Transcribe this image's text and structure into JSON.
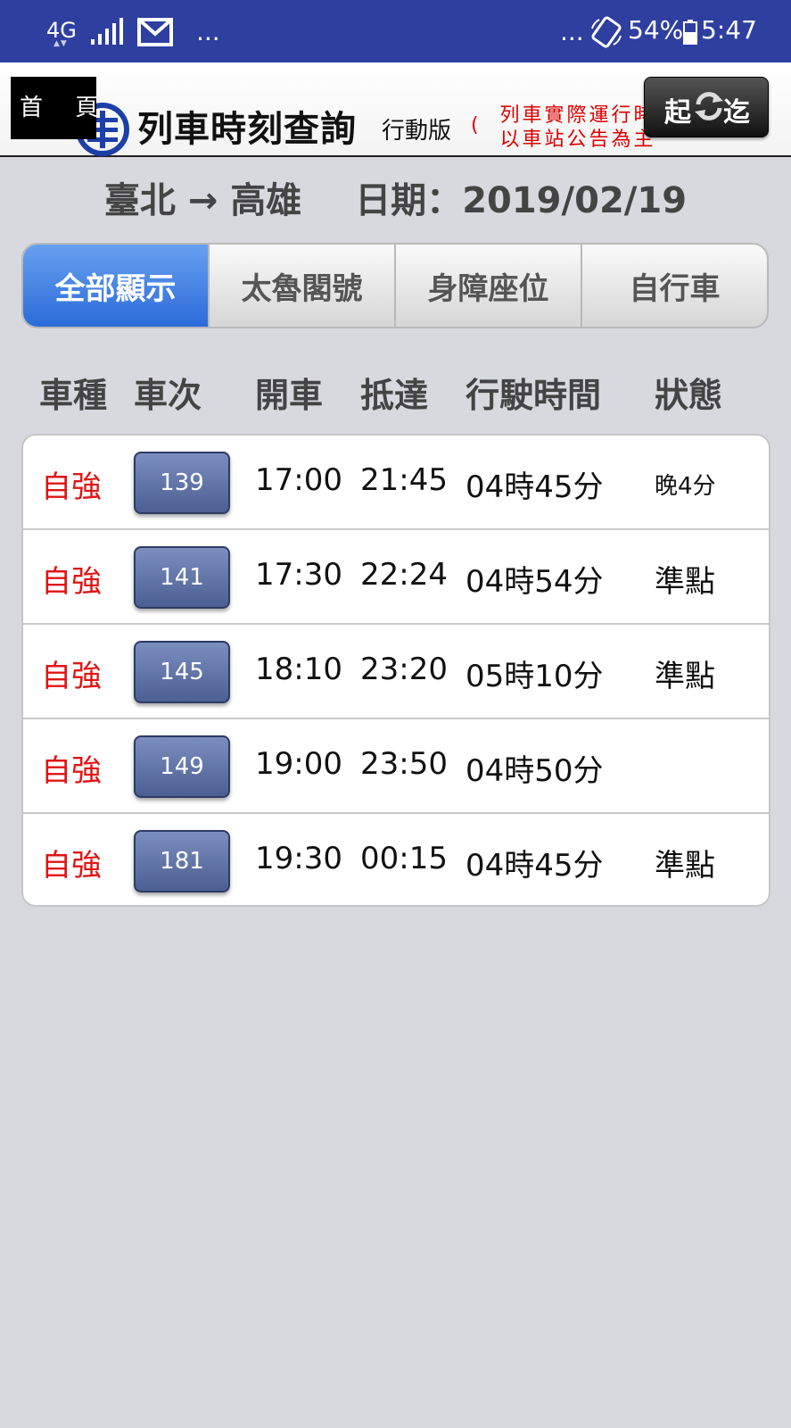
{
  "status_bar": {
    "network": "4G",
    "dots_left": "...",
    "dots_right": "...",
    "battery": "54%",
    "time": "5:47"
  },
  "header": {
    "home_label": "首 頁",
    "title": "列車時刻查詢",
    "subtitle": "行動版",
    "paren": "(",
    "notice_line1": "列車實際運行時",
    "notice_line2": "以車站公告為主",
    "swap_from": "起",
    "swap_to": "迄"
  },
  "route": {
    "from": "臺北",
    "arrow": "→",
    "to": "高雄",
    "date_label": "日期：",
    "date": "2019/02/19"
  },
  "tabs": [
    {
      "label": "全部顯示"
    },
    {
      "label": "太魯閣號"
    },
    {
      "label": "身障座位"
    },
    {
      "label": "自行車"
    }
  ],
  "columns": {
    "type": "車種",
    "train": "車次",
    "depart": "開車",
    "arrive": "抵達",
    "duration": "行駛時間",
    "status": "狀態"
  },
  "rows": [
    {
      "type": "自強",
      "train": "139",
      "depart": "17:00",
      "arrive": "21:45",
      "duration": "04時45分",
      "status": "晚4分"
    },
    {
      "type": "自強",
      "train": "141",
      "depart": "17:30",
      "arrive": "22:24",
      "duration": "04時54分",
      "status": "準點"
    },
    {
      "type": "自強",
      "train": "145",
      "depart": "18:10",
      "arrive": "23:20",
      "duration": "05時10分",
      "status": "準點"
    },
    {
      "type": "自強",
      "train": "149",
      "depart": "19:00",
      "arrive": "23:50",
      "duration": "04時50分",
      "status": ""
    },
    {
      "type": "自強",
      "train": "181",
      "depart": "19:30",
      "arrive": "00:15",
      "duration": "04時45分",
      "status": "準點"
    }
  ],
  "colors": {
    "status_bar": "#2f3f9f",
    "active_tab": "#2b6bd8",
    "train_type": "#e01515",
    "background": "#d8d9de"
  }
}
